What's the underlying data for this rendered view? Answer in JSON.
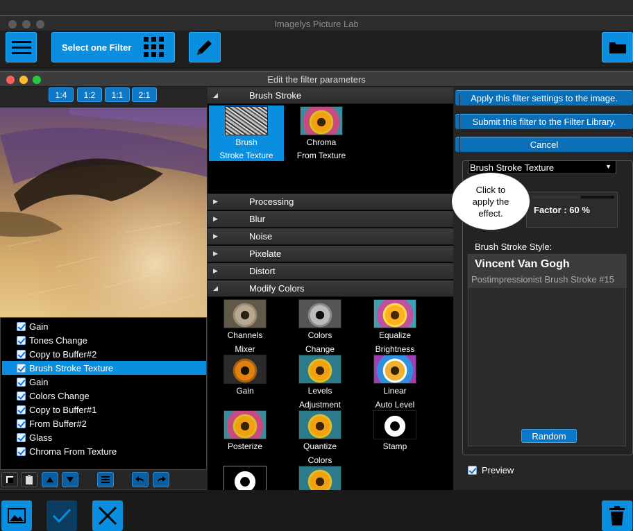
{
  "main_window": {
    "title": "Imagelys Picture Lab",
    "select_filter_label": "Select one Filter",
    "icons": {
      "menu": "hamburger-menu-icon",
      "grid": "grid-icon",
      "edit": "pencil-icon",
      "folder": "folder-icon",
      "image": "image-icon",
      "check": "checkmark-icon",
      "close": "close-icon",
      "trash": "trash-icon"
    }
  },
  "dialog": {
    "title": "Edit the filter parameters",
    "zoom": [
      "1:4",
      "1:2",
      "1:1",
      "2:1"
    ],
    "stack": [
      {
        "label": "Gain",
        "checked": true,
        "selected": false
      },
      {
        "label": "Tones Change",
        "checked": true,
        "selected": false
      },
      {
        "label": "Copy to Buffer#2",
        "checked": true,
        "selected": false
      },
      {
        "label": "Brush Stroke Texture",
        "checked": true,
        "selected": true
      },
      {
        "label": "Gain",
        "checked": true,
        "selected": false
      },
      {
        "label": "Colors Change",
        "checked": true,
        "selected": false
      },
      {
        "label": "Copy to Buffer#1",
        "checked": true,
        "selected": false
      },
      {
        "label": "From Buffer#2",
        "checked": true,
        "selected": false
      },
      {
        "label": "Glass",
        "checked": true,
        "selected": false
      },
      {
        "label": "Chroma From Texture",
        "checked": true,
        "selected": false
      }
    ],
    "categories": {
      "brush_stroke": {
        "label": "Brush Stroke",
        "filters": [
          {
            "l1": "Brush",
            "l2": "Stroke Texture"
          },
          {
            "l1": "Chroma",
            "l2": "From Texture"
          }
        ]
      },
      "collapsed": [
        "Processing",
        "Blur",
        "Noise",
        "Pixelate",
        "Distort"
      ],
      "modify_colors": {
        "label": "Modify Colors",
        "filters": [
          {
            "l1": "Channels",
            "l2": "Mixer"
          },
          {
            "l1": "Colors",
            "l2": "Change"
          },
          {
            "l1": "Equalize",
            "l2": "Brightness"
          },
          {
            "l1": "Gain",
            "l2": ""
          },
          {
            "l1": "Levels",
            "l2": "Adjustment"
          },
          {
            "l1": "Linear",
            "l2": "Auto Level"
          },
          {
            "l1": "Posterize",
            "l2": ""
          },
          {
            "l1": "Quantize",
            "l2": "Colors"
          },
          {
            "l1": "Stamp",
            "l2": ""
          }
        ]
      }
    },
    "actions": {
      "apply": "Apply this filter settings to the image.",
      "submit": "Submit this filter to the Filter Library.",
      "cancel": "Cancel"
    },
    "params": {
      "filter_select": "Brush Stroke Texture",
      "factor_label": "Factor : 60 %",
      "factor_value": 60,
      "style_label": "Brush Stroke Style:",
      "style_name": "Vincent Van Gogh",
      "style_sub": "Postimpressionist Brush Stroke #15",
      "random_label": "Random",
      "preview_label": "Preview",
      "preview_checked": true
    },
    "callout": {
      "l1": "Click to",
      "l2": "apply the",
      "l3": "effect."
    }
  }
}
